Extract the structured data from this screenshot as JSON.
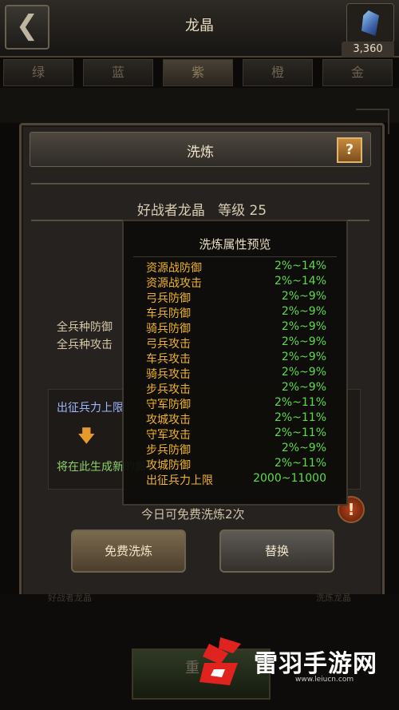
{
  "top_bar": {
    "title": "龙晶",
    "crystal_count": "3,360"
  },
  "tabs": [
    {
      "label": "绿"
    },
    {
      "label": "蓝"
    },
    {
      "label": "紫"
    },
    {
      "label": "橙"
    },
    {
      "label": "金"
    }
  ],
  "dialog": {
    "title": "洗炼",
    "help_label": "?",
    "crystal_name": "好战者龙晶",
    "level_text": "等级 25",
    "stats": [
      "全兵种防御",
      "全兵种攻击"
    ],
    "generate_caption": "出征兵力上限",
    "generate_note": "将在此生成新的属性",
    "free_count_text": "今日可免费洗炼2次",
    "warn_label": "!",
    "free_button": "免费洗炼",
    "replace_button": "替换"
  },
  "preview": {
    "title": "洗炼属性预览",
    "rows": [
      {
        "name": "资源战防御",
        "value": "2%~14%"
      },
      {
        "name": "资源战攻击",
        "value": "2%~14%"
      },
      {
        "name": "弓兵防御",
        "value": "2%~9%"
      },
      {
        "name": "车兵防御",
        "value": "2%~9%"
      },
      {
        "name": "骑兵防御",
        "value": "2%~9%"
      },
      {
        "name": "弓兵攻击",
        "value": "2%~9%"
      },
      {
        "name": "车兵攻击",
        "value": "2%~9%"
      },
      {
        "name": "骑兵攻击",
        "value": "2%~9%"
      },
      {
        "name": "步兵攻击",
        "value": "2%~9%"
      },
      {
        "name": "守军防御",
        "value": "2%~11%"
      },
      {
        "name": "攻城攻击",
        "value": "2%~11%"
      },
      {
        "name": "守军攻击",
        "value": "2%~11%"
      },
      {
        "name": "步兵防御",
        "value": "2%~9%"
      },
      {
        "name": "攻城防御",
        "value": "2%~11%"
      },
      {
        "name": "出征兵力上限",
        "value": "2000~11000"
      }
    ]
  },
  "bottom": {
    "ghost_left": "好战者龙晶",
    "ghost_right": "洗炼龙晶",
    "button_label": "重"
  },
  "watermark": {
    "brand": "雷羽手游网",
    "url": "www.leiucn.com"
  },
  "colors": {
    "attribute_name": "#f0b429",
    "attribute_value": "#5edb4b",
    "caption_blue": "#9fb7ff",
    "note_green": "#8ed16a",
    "logo_red": "#e0231e"
  }
}
